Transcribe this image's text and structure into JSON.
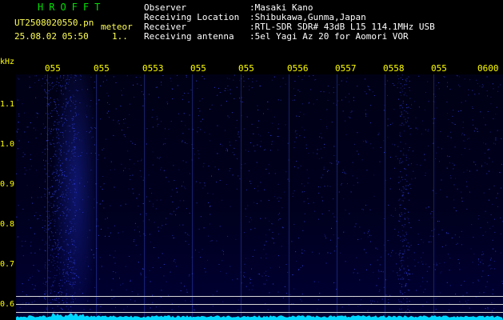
{
  "header": {
    "app_title": "HROFFT",
    "file_name": "UT2508020550.pn",
    "file_tag": "meteor",
    "datetime": "25.08.02 05:50",
    "datetime_extra": "1..",
    "info": [
      {
        "key": "Observer",
        "value": ":Masaki Kano"
      },
      {
        "key": "Receiving Location",
        "value": ":Shibukawa,Gunma,Japan"
      },
      {
        "key": "Receiver",
        "value": ":RTL-SDR SDR# 43dB L15 114.1MHz USB"
      },
      {
        "key": "Receiving antenna",
        "value": ":5el Yagi Az 20 for Aomori VOR"
      }
    ]
  },
  "time_axis": {
    "labels": [
      "055",
      "055",
      "0553",
      "055",
      "055",
      "0556",
      "0557",
      "0558",
      "055",
      "0600"
    ]
  },
  "freq_axis": {
    "unit": "kHz",
    "labels": [
      "1.1",
      "1.0",
      "0.9",
      "0.8",
      "0.7",
      "0.6"
    ]
  },
  "colors": {
    "background": "#000000",
    "header_text": "#ffffff",
    "yellow_text": "#ffff00",
    "title_green": "#00e000",
    "waterfall_dot": "#3a4cff",
    "spectrum": "#00d8ff"
  }
}
